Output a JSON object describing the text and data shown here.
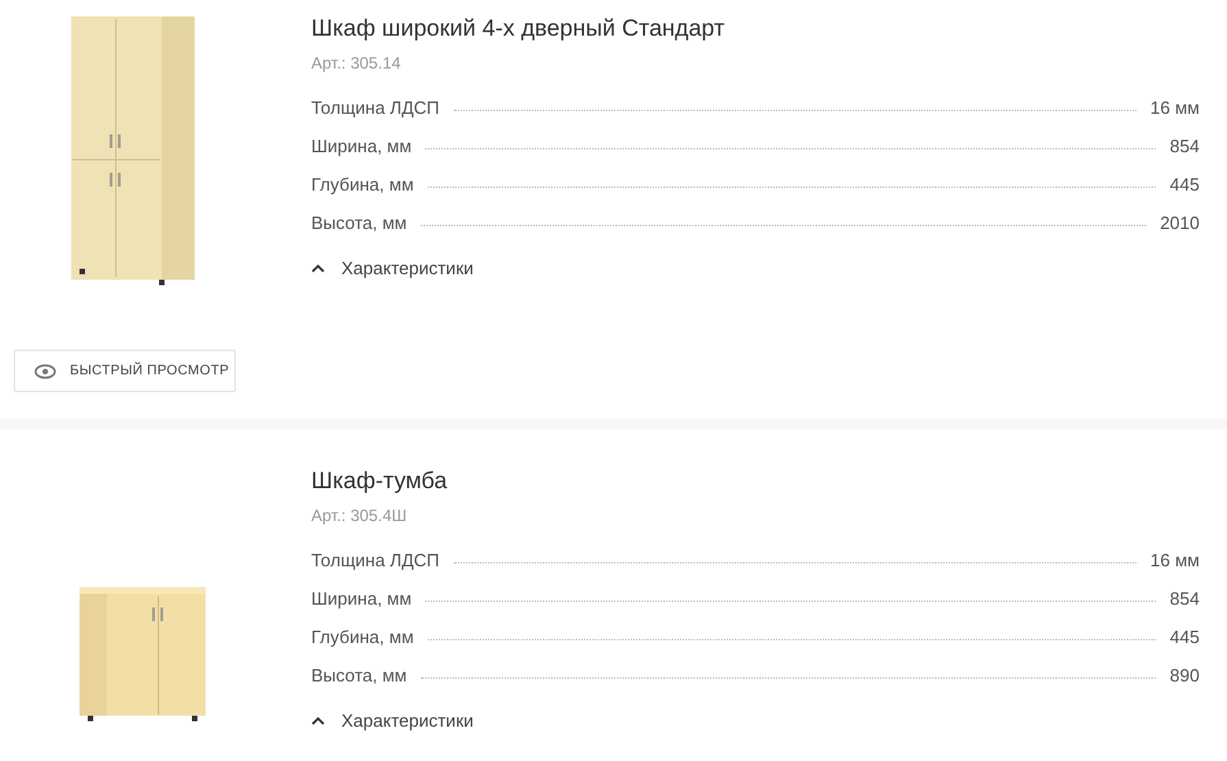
{
  "products": [
    {
      "title": "Шкаф широкий 4-х дверный Стандарт",
      "article": "Арт.: 305.14",
      "specs": [
        {
          "label": "Толщина ЛДСП",
          "value": "16 мм"
        },
        {
          "label": "Ширина, мм",
          "value": "854"
        },
        {
          "label": "Глубина, мм",
          "value": "445"
        },
        {
          "label": "Высота, мм",
          "value": "2010"
        }
      ],
      "characteristics": {
        "label": "Характеристики",
        "expanded": true
      },
      "quick_view": "БЫСТРЫЙ ПРОСМОТР"
    },
    {
      "title": "Шкаф-тумба",
      "article": "Арт.: 305.4Ш",
      "specs": [
        {
          "label": "Толщина ЛДСП",
          "value": "16 мм"
        },
        {
          "label": "Ширина, мм",
          "value": "854"
        },
        {
          "label": "Глубина, мм",
          "value": "445"
        },
        {
          "label": "Высота, мм",
          "value": "890"
        }
      ],
      "characteristics": {
        "label": "Характеристики",
        "expanded": true
      }
    }
  ]
}
